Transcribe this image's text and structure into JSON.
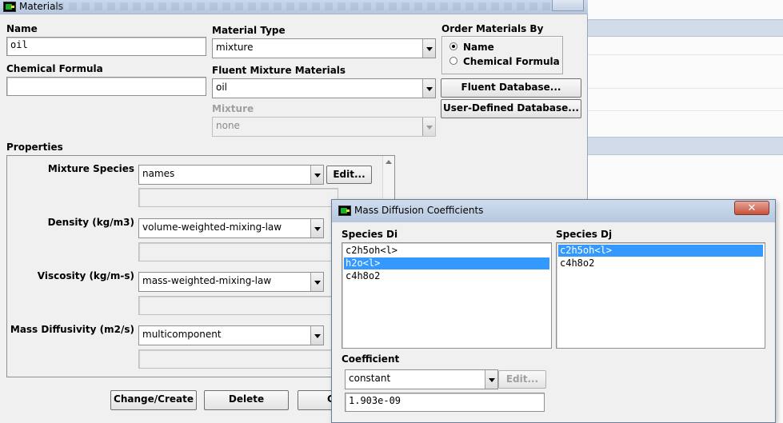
{
  "materials_window": {
    "title": "Materials",
    "name_label": "Name",
    "name_value": "oil",
    "chemical_formula_label": "Chemical Formula",
    "chemical_formula_value": "",
    "material_type_label": "Material Type",
    "material_type_value": "mixture",
    "fluent_mixture_label": "Fluent Mixture Materials",
    "fluent_mixture_value": "oil",
    "mixture_label": "Mixture",
    "mixture_value": "none",
    "order_by_label": "Order Materials By",
    "order_options": [
      "Name",
      "Chemical Formula"
    ],
    "order_selected": "Name",
    "fluent_db_button": "Fluent Database...",
    "user_db_button": "User-Defined Database...",
    "properties_label": "Properties",
    "properties": [
      {
        "label": "Mixture Species",
        "value": "names",
        "button": "Edit..."
      },
      {
        "label": "Density (kg/m3)",
        "value": "volume-weighted-mixing-law"
      },
      {
        "label": "Viscosity (kg/m-s)",
        "value": "mass-weighted-mixing-law"
      },
      {
        "label": "Mass Diffusivity (m2/s)",
        "value": "multicomponent"
      }
    ],
    "bottom_buttons": {
      "change_create": "Change/Create",
      "delete": "Delete",
      "close_partial": "C"
    }
  },
  "diffusion_dialog": {
    "title": "Mass Diffusion Coefficients",
    "species_di_label": "Species Di",
    "species_di": [
      "c2h5oh<l>",
      "h2o<l>",
      "c4h8o2"
    ],
    "species_di_selected": "h2o<l>",
    "species_dj_label": "Species Dj",
    "species_dj": [
      "c2h5oh<l>",
      "c4h8o2"
    ],
    "species_dj_selected": "c2h5oh<l>",
    "coefficient_label": "Coefficient",
    "coefficient_method": "constant",
    "edit_button": "Edit...",
    "coefficient_value": "1.903e-09"
  }
}
